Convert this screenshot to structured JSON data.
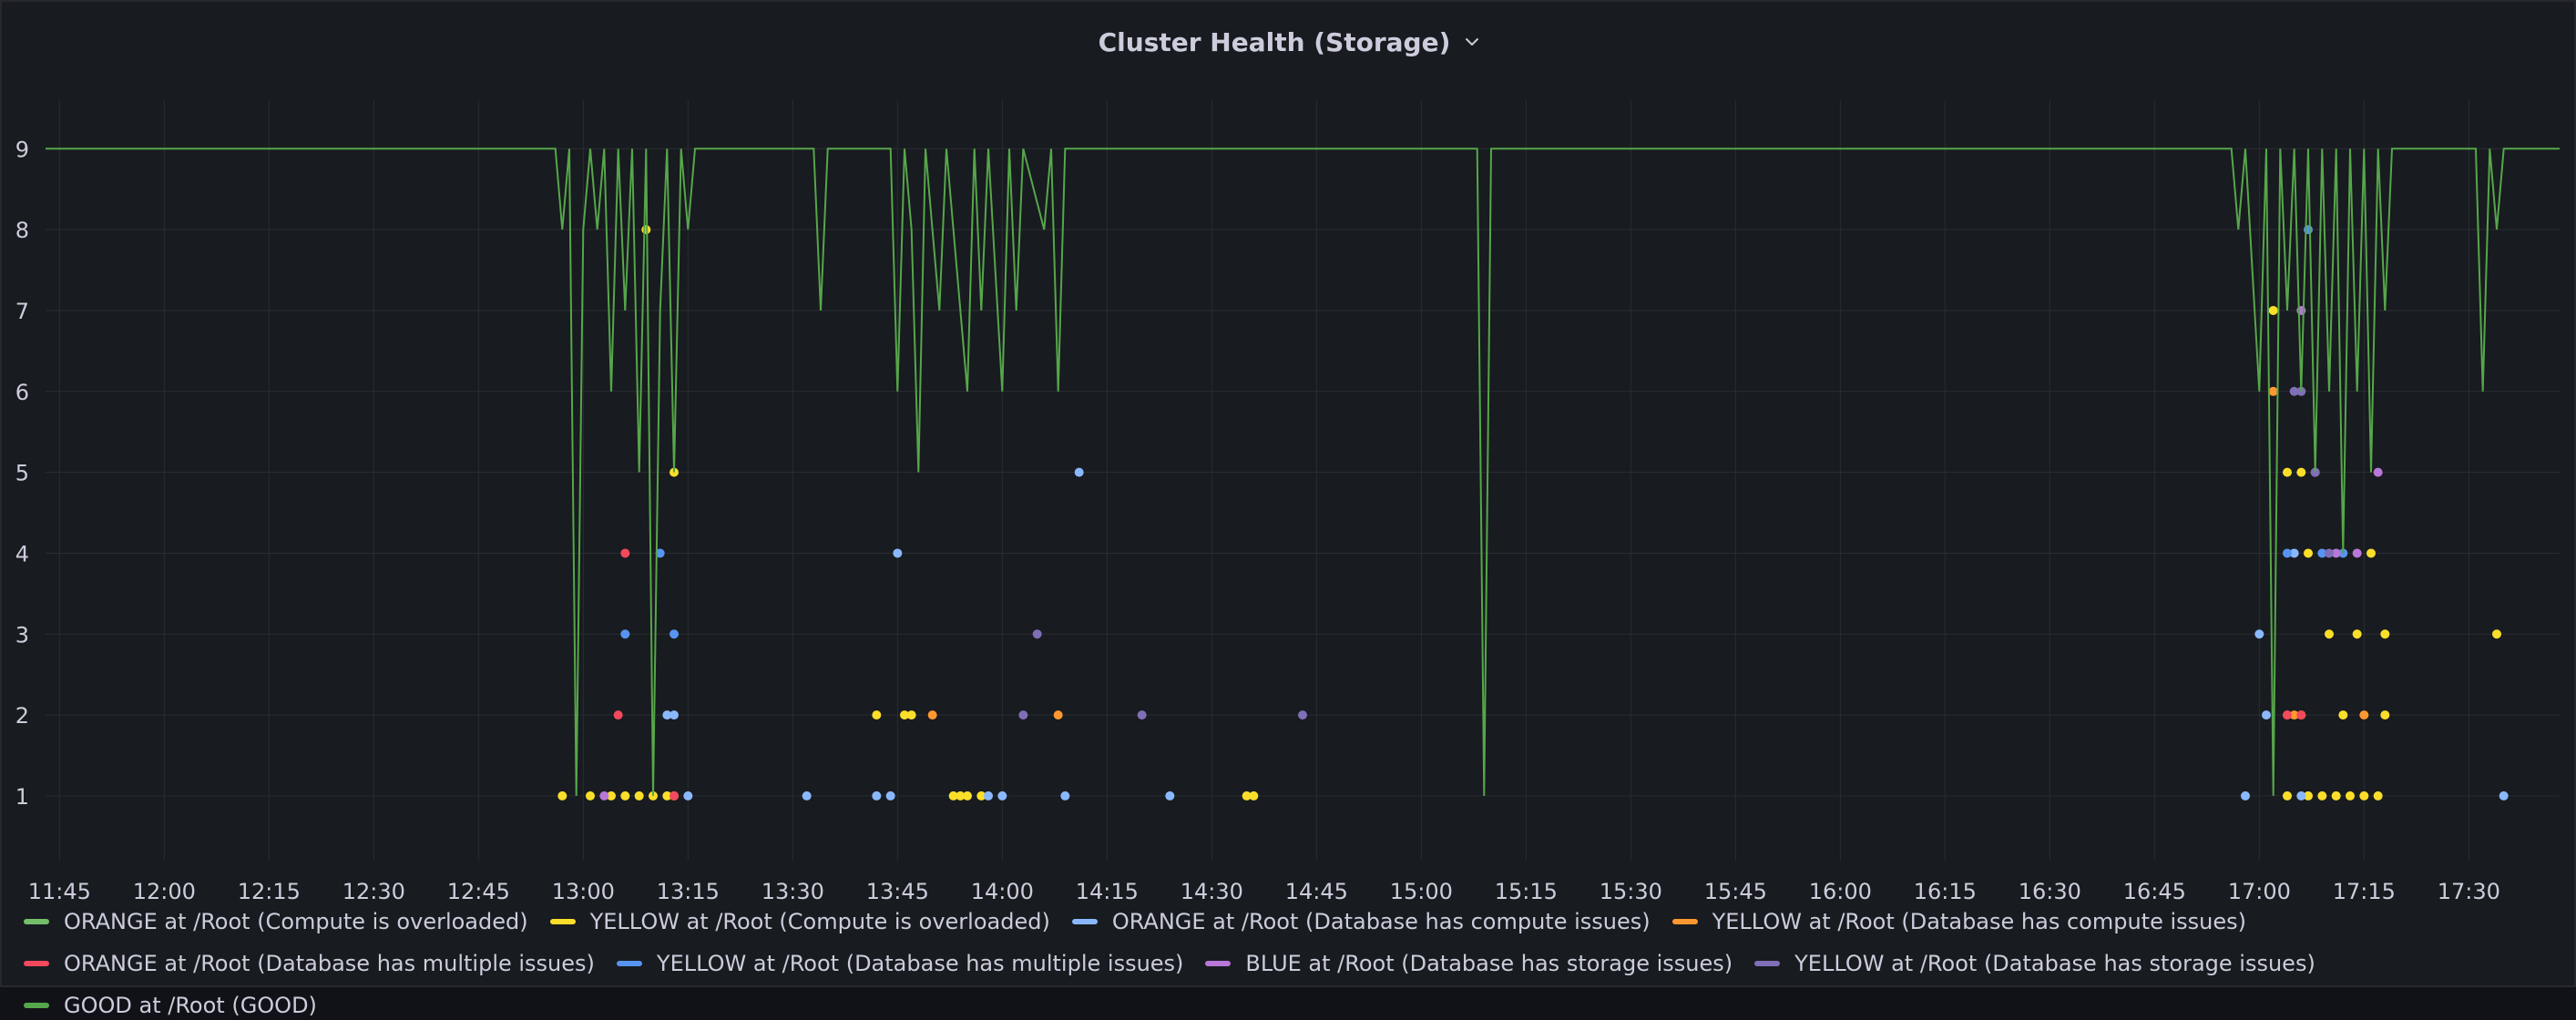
{
  "panel": {
    "title": "Cluster Health (Storage)",
    "menu_icon": "chevron-down-icon"
  },
  "chart_data": {
    "type": "line",
    "title": "Cluster Health (Storage)",
    "xlabel": "",
    "ylabel": "",
    "x_ticks": [
      "11:45",
      "12:00",
      "12:15",
      "12:30",
      "12:45",
      "13:00",
      "13:15",
      "13:30",
      "13:45",
      "14:00",
      "14:15",
      "14:30",
      "14:45",
      "15:00",
      "15:15",
      "15:30",
      "15:45",
      "16:00",
      "16:15",
      "16:30",
      "16:45",
      "17:00",
      "17:15",
      "17:30"
    ],
    "y_ticks": [
      1,
      2,
      3,
      4,
      5,
      6,
      7,
      8,
      9
    ],
    "xlim": [
      "11:43",
      "17:43"
    ],
    "ylim": [
      0.2,
      9.6
    ],
    "grid": true,
    "legend_position": "bottom",
    "series": [
      {
        "name": "ORANGE at /Root (Compute is overloaded)",
        "color": "#73bf69",
        "points": []
      },
      {
        "name": "YELLOW at /Root (Compute is overloaded)",
        "color": "#fade2a",
        "points": [
          [
            "12:57",
            1
          ],
          [
            "13:01",
            1
          ],
          [
            "13:04",
            1
          ],
          [
            "13:06",
            1
          ],
          [
            "13:08",
            1
          ],
          [
            "13:09",
            8
          ],
          [
            "13:10",
            1
          ],
          [
            "13:12",
            1
          ],
          [
            "13:13",
            5
          ],
          [
            "13:13",
            1
          ],
          [
            "13:42",
            2
          ],
          [
            "13:46",
            2
          ],
          [
            "13:47",
            2
          ],
          [
            "13:53",
            1
          ],
          [
            "13:54",
            1
          ],
          [
            "13:55",
            1
          ],
          [
            "13:57",
            1
          ],
          [
            "14:35",
            1
          ],
          [
            "14:36",
            1
          ],
          [
            "17:02",
            7
          ],
          [
            "17:04",
            5
          ],
          [
            "17:04",
            1
          ],
          [
            "17:06",
            5
          ],
          [
            "17:07",
            4
          ],
          [
            "17:07",
            1
          ],
          [
            "17:09",
            1
          ],
          [
            "17:10",
            3
          ],
          [
            "17:11",
            1
          ],
          [
            "17:12",
            2
          ],
          [
            "17:13",
            1
          ],
          [
            "17:14",
            3
          ],
          [
            "17:15",
            1
          ],
          [
            "17:16",
            4
          ],
          [
            "17:17",
            1
          ],
          [
            "17:18",
            3
          ],
          [
            "17:18",
            2
          ],
          [
            "17:34",
            3
          ]
        ]
      },
      {
        "name": "ORANGE at /Root (Database has compute issues)",
        "color": "#8ab8ff",
        "points": [
          [
            "13:12",
            2
          ],
          [
            "13:13",
            2
          ],
          [
            "13:15",
            1
          ],
          [
            "13:32",
            1
          ],
          [
            "13:42",
            1
          ],
          [
            "13:44",
            1
          ],
          [
            "13:45",
            4
          ],
          [
            "13:58",
            1
          ],
          [
            "14:00",
            1
          ],
          [
            "14:09",
            1
          ],
          [
            "14:11",
            5
          ],
          [
            "14:24",
            1
          ],
          [
            "16:58",
            1
          ],
          [
            "17:00",
            3
          ],
          [
            "17:01",
            2
          ],
          [
            "17:05",
            4
          ],
          [
            "17:06",
            1
          ],
          [
            "17:35",
            1
          ]
        ]
      },
      {
        "name": "YELLOW at /Root (Database has compute issues)",
        "color": "#ff9830",
        "points": [
          [
            "13:50",
            2
          ],
          [
            "14:08",
            2
          ],
          [
            "17:02",
            6
          ],
          [
            "17:04",
            2
          ],
          [
            "17:05",
            2
          ],
          [
            "17:06",
            2
          ],
          [
            "17:15",
            2
          ]
        ]
      },
      {
        "name": "ORANGE at /Root (Database has multiple issues)",
        "color": "#f2495c",
        "points": [
          [
            "13:05",
            2
          ],
          [
            "13:06",
            4
          ],
          [
            "13:13",
            1
          ],
          [
            "17:04",
            2
          ],
          [
            "17:06",
            2
          ]
        ]
      },
      {
        "name": "YELLOW at /Root (Database has multiple issues)",
        "color": "#5794f2",
        "points": [
          [
            "13:06",
            3
          ],
          [
            "13:11",
            4
          ],
          [
            "13:13",
            3
          ],
          [
            "17:04",
            4
          ],
          [
            "17:07",
            8
          ],
          [
            "17:09",
            4
          ],
          [
            "17:12",
            4
          ]
        ]
      },
      {
        "name": "BLUE at /Root (Database has storage issues)",
        "color": "#b877d9",
        "points": [
          [
            "13:03",
            1
          ],
          [
            "17:06",
            7
          ],
          [
            "17:08",
            5
          ],
          [
            "17:11",
            4
          ],
          [
            "17:14",
            4
          ],
          [
            "17:17",
            5
          ]
        ]
      },
      {
        "name": "YELLOW at /Root (Database has storage issues)",
        "color": "#806eb7",
        "points": [
          [
            "14:05",
            3
          ],
          [
            "14:03",
            2
          ],
          [
            "14:20",
            2
          ],
          [
            "14:43",
            2
          ],
          [
            "17:05",
            6
          ],
          [
            "17:06",
            6
          ],
          [
            "17:08",
            5
          ],
          [
            "17:10",
            4
          ]
        ]
      },
      {
        "name": "GOOD at /Root (GOOD)",
        "color": "#56a64b",
        "points": [
          [
            "11:43",
            9
          ],
          [
            "12:56",
            9
          ],
          [
            "12:57",
            8
          ],
          [
            "12:58",
            9
          ],
          [
            "12:59",
            1
          ],
          [
            "13:00",
            8
          ],
          [
            "13:01",
            9
          ],
          [
            "13:02",
            8
          ],
          [
            "13:03",
            9
          ],
          [
            "13:04",
            6
          ],
          [
            "13:05",
            9
          ],
          [
            "13:06",
            7
          ],
          [
            "13:07",
            9
          ],
          [
            "13:08",
            5
          ],
          [
            "13:09",
            9
          ],
          [
            "13:10",
            1
          ],
          [
            "13:11",
            7
          ],
          [
            "13:12",
            9
          ],
          [
            "13:13",
            5
          ],
          [
            "13:14",
            9
          ],
          [
            "13:15",
            8
          ],
          [
            "13:16",
            9
          ],
          [
            "13:33",
            9
          ],
          [
            "13:34",
            7
          ],
          [
            "13:35",
            9
          ],
          [
            "13:44",
            9
          ],
          [
            "13:45",
            6
          ],
          [
            "13:46",
            9
          ],
          [
            "13:47",
            8
          ],
          [
            "13:48",
            5
          ],
          [
            "13:49",
            9
          ],
          [
            "13:51",
            7
          ],
          [
            "13:52",
            9
          ],
          [
            "13:55",
            6
          ],
          [
            "13:56",
            9
          ],
          [
            "13:57",
            7
          ],
          [
            "13:58",
            9
          ],
          [
            "14:00",
            6
          ],
          [
            "14:01",
            9
          ],
          [
            "14:02",
            7
          ],
          [
            "14:03",
            9
          ],
          [
            "14:06",
            8
          ],
          [
            "14:07",
            9
          ],
          [
            "14:08",
            6
          ],
          [
            "14:09",
            9
          ],
          [
            "14:11",
            9
          ],
          [
            "15:08",
            9
          ],
          [
            "15:09",
            1
          ],
          [
            "15:10",
            9
          ],
          [
            "16:56",
            9
          ],
          [
            "16:57",
            8
          ],
          [
            "16:58",
            9
          ],
          [
            "17:00",
            6
          ],
          [
            "17:01",
            9
          ],
          [
            "17:02",
            1
          ],
          [
            "17:03",
            9
          ],
          [
            "17:04",
            7
          ],
          [
            "17:05",
            9
          ],
          [
            "17:06",
            6
          ],
          [
            "17:07",
            9
          ],
          [
            "17:08",
            5
          ],
          [
            "17:09",
            9
          ],
          [
            "17:10",
            6
          ],
          [
            "17:11",
            9
          ],
          [
            "17:12",
            4
          ],
          [
            "17:13",
            9
          ],
          [
            "17:14",
            6
          ],
          [
            "17:15",
            9
          ],
          [
            "17:16",
            5
          ],
          [
            "17:17",
            9
          ],
          [
            "17:18",
            7
          ],
          [
            "17:19",
            9
          ],
          [
            "17:31",
            9
          ],
          [
            "17:32",
            6
          ],
          [
            "17:33",
            9
          ],
          [
            "17:34",
            8
          ],
          [
            "17:35",
            9
          ],
          [
            "17:43",
            9
          ]
        ]
      }
    ]
  }
}
